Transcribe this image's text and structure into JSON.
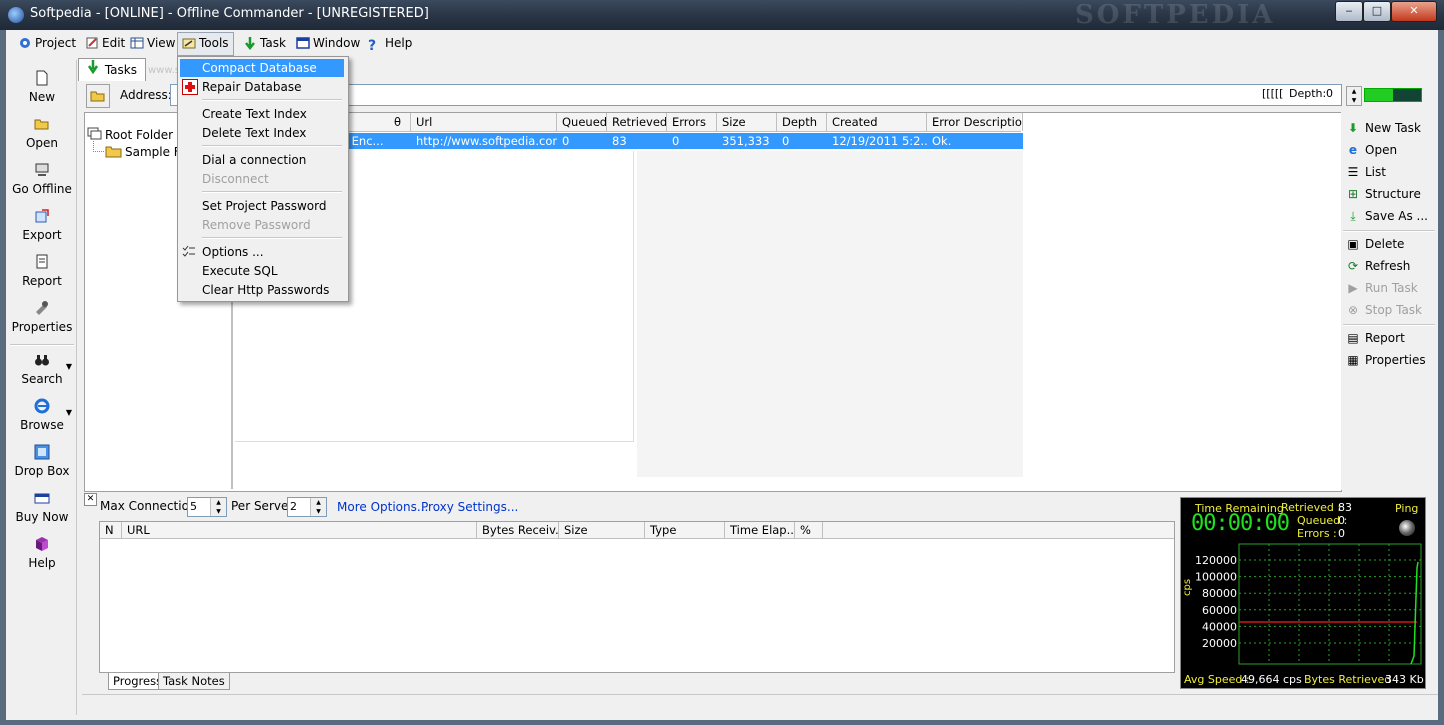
{
  "window": {
    "title": "Softpedia - [ONLINE] - Offline Commander - [UNREGISTERED]",
    "watermark": "SOFTPEDIA",
    "controls": {
      "minimize": "‒",
      "maximize": "□",
      "close": "✕"
    }
  },
  "menubar": [
    "Project",
    "Edit",
    "View",
    "Tools",
    "Task",
    "Window",
    "Help"
  ],
  "left_toolbar": [
    {
      "label": "New",
      "icon": "new-page-icon"
    },
    {
      "label": "Open",
      "icon": "open-folder-icon"
    },
    {
      "label": "Go Offline",
      "icon": "computer-icon"
    },
    {
      "label": "Export",
      "icon": "export-icon"
    },
    {
      "label": "Report",
      "icon": "report-icon"
    },
    {
      "label": "Properties",
      "icon": "properties-icon"
    },
    {
      "label": "Search",
      "icon": "binoculars-icon"
    },
    {
      "label": "Browse",
      "icon": "ie-icon"
    },
    {
      "label": "Drop Box",
      "icon": "dropbox-icon"
    },
    {
      "label": "Buy Now",
      "icon": "buy-icon"
    },
    {
      "label": "Help",
      "icon": "help-book-icon"
    }
  ],
  "tabs": {
    "tasks": "Tasks",
    "watermark": "www.softpedia.com"
  },
  "address": {
    "label": "Address:",
    "depth_label": "Depth:",
    "depth_value": "0",
    "depth_prefix": "[[[[["
  },
  "tree": {
    "root": "Root Folder",
    "child": "Sample Fo"
  },
  "columns": [
    "Url",
    "Queued",
    "Retrieved",
    "Errors",
    "Size",
    "Depth",
    "Created",
    "Error Description"
  ],
  "hidden_col_glyph": "θ",
  "row": {
    "name_partial": "s Enc...",
    "url": "http://www.softpedia.com/",
    "queued": "0",
    "retrieved": "83",
    "errors": "0",
    "size": "351,333",
    "depth": "0",
    "created": "12/19/2011 5:2...",
    "error_description": "Ok."
  },
  "tools_menu": {
    "items": [
      {
        "label": "Compact Database",
        "state": "highlighted"
      },
      {
        "label": "Repair Database",
        "state": "normal"
      },
      {
        "label": "Create Text Index",
        "state": "normal"
      },
      {
        "label": "Delete Text Index",
        "state": "normal"
      },
      {
        "label": "Dial a connection",
        "state": "normal"
      },
      {
        "label": "Disconnect",
        "state": "disabled"
      },
      {
        "label": "Set Project Password",
        "state": "normal"
      },
      {
        "label": "Remove Password",
        "state": "disabled"
      },
      {
        "label": "Options ...",
        "state": "normal"
      },
      {
        "label": "Execute SQL",
        "state": "normal"
      },
      {
        "label": "Clear Http Passwords",
        "state": "normal"
      }
    ]
  },
  "right_panel": [
    {
      "label": "New Task",
      "state": "normal"
    },
    {
      "label": "Open",
      "state": "normal"
    },
    {
      "label": "List",
      "state": "normal"
    },
    {
      "label": "Structure",
      "state": "normal"
    },
    {
      "label": "Save As ...",
      "state": "normal"
    },
    {
      "label": "Delete",
      "state": "normal"
    },
    {
      "label": "Refresh",
      "state": "normal"
    },
    {
      "label": "Run Task",
      "state": "disabled"
    },
    {
      "label": "Stop Task",
      "state": "disabled"
    },
    {
      "label": "Report",
      "state": "normal"
    },
    {
      "label": "Properties",
      "state": "normal"
    }
  ],
  "bottom": {
    "close_glyph": "✕",
    "max_connections_label": "Max Connections :",
    "max_connections_value": "5",
    "per_server_label": "Per Server :",
    "per_server_value": "2",
    "more_options": "More Options...",
    "proxy_settings": "Proxy Settings...",
    "columns": [
      "N",
      "URL",
      "Bytes Receiv...",
      "Size",
      "Type",
      "Time Elap...",
      "%"
    ],
    "tabs": [
      "Progress",
      "Task Notes"
    ]
  },
  "gauge": {
    "time_remaining_label": "Time Remaining",
    "time": "00:00:00",
    "retrieved_label": "Retrieved :",
    "retrieved": "83",
    "queued_label": "Queued :",
    "queued": "0",
    "errors_label": "Errors :",
    "errors": "0",
    "ping_label": "Ping",
    "axis_label": "cps",
    "ticks": [
      "120000",
      "100000",
      "80000",
      "60000",
      "40000",
      "20000"
    ],
    "avg_speed_label": "Avg Speed :",
    "avg_speed": "49,664 cps",
    "bytes_label": "Bytes Retrieved :",
    "bytes": "343 Kb",
    "colors": {
      "text": "#f0ee3a",
      "grid": "#2aa02a",
      "avg_line": "#d01818",
      "trace": "#20e020"
    }
  }
}
